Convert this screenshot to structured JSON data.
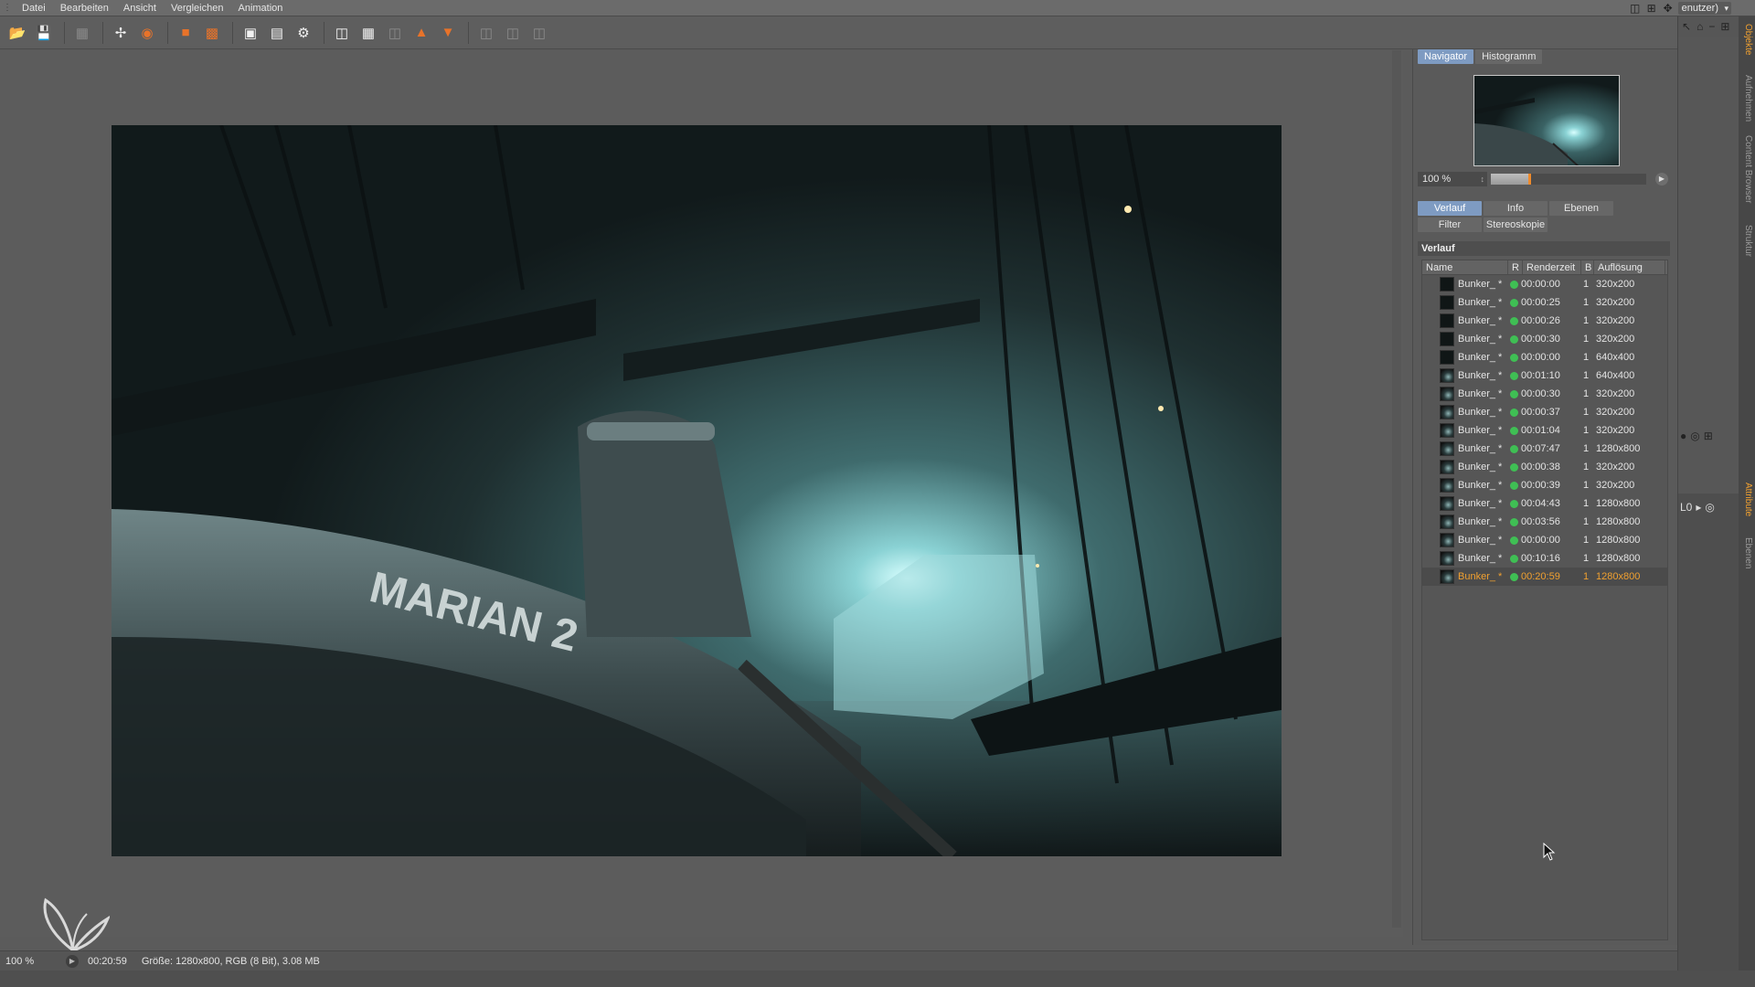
{
  "menu": {
    "items": [
      "Datei",
      "Bearbeiten",
      "Ansicht",
      "Vergleichen",
      "Animation"
    ],
    "layout_label": "enutzer)"
  },
  "toolbar": {
    "icons": [
      "open-icon",
      "save-icon",
      "grid-icon",
      "fit-icon",
      "person-icon",
      "stop-icon",
      "stack-icon",
      "render-region-icon",
      "render-view-icon",
      "render-settings-icon",
      "compare-ab-icon",
      "compare-grid-icon",
      "ab-icon",
      "set-a-icon",
      "set-b-icon",
      "split-h-icon",
      "split-v-icon",
      "split-diag-icon"
    ]
  },
  "navigator": {
    "tabs": [
      "Navigator",
      "Histogramm"
    ],
    "zoom_value": "100 %",
    "zoom_fraction": 0.25
  },
  "panel": {
    "tabs_row1": [
      "Verlauf",
      "Info",
      "Ebenen"
    ],
    "tabs_row2": [
      "Filter",
      "Stereoskopie"
    ],
    "section_title": "Verlauf",
    "columns": {
      "name": "Name",
      "r": "R",
      "time": "Renderzeit",
      "b": "B",
      "res": "Auflösung"
    },
    "rows": [
      {
        "name": "Bunker_ *",
        "time": "00:00:00",
        "b": "1",
        "res": "320x200"
      },
      {
        "name": "Bunker_ *",
        "time": "00:00:25",
        "b": "1",
        "res": "320x200"
      },
      {
        "name": "Bunker_ *",
        "time": "00:00:26",
        "b": "1",
        "res": "320x200"
      },
      {
        "name": "Bunker_ *",
        "time": "00:00:30",
        "b": "1",
        "res": "320x200"
      },
      {
        "name": "Bunker_ *",
        "time": "00:00:00",
        "b": "1",
        "res": "640x400"
      },
      {
        "name": "Bunker_ *",
        "time": "00:01:10",
        "b": "1",
        "res": "640x400"
      },
      {
        "name": "Bunker_ *",
        "time": "00:00:30",
        "b": "1",
        "res": "320x200"
      },
      {
        "name": "Bunker_ *",
        "time": "00:00:37",
        "b": "1",
        "res": "320x200"
      },
      {
        "name": "Bunker_ *",
        "time": "00:01:04",
        "b": "1",
        "res": "320x200"
      },
      {
        "name": "Bunker_ *",
        "time": "00:07:47",
        "b": "1",
        "res": "1280x800"
      },
      {
        "name": "Bunker_ *",
        "time": "00:00:38",
        "b": "1",
        "res": "320x200"
      },
      {
        "name": "Bunker_ *",
        "time": "00:00:39",
        "b": "1",
        "res": "320x200"
      },
      {
        "name": "Bunker_ *",
        "time": "00:04:43",
        "b": "1",
        "res": "1280x800"
      },
      {
        "name": "Bunker_ *",
        "time": "00:03:56",
        "b": "1",
        "res": "1280x800"
      },
      {
        "name": "Bunker_ *",
        "time": "00:00:00",
        "b": "1",
        "res": "1280x800"
      },
      {
        "name": "Bunker_ *",
        "time": "00:10:16",
        "b": "1",
        "res": "1280x800"
      },
      {
        "name": "Bunker_ *",
        "time": "00:20:59",
        "b": "1",
        "res": "1280x800",
        "selected": true
      }
    ]
  },
  "image": {
    "hull_text": "MARIAN 2"
  },
  "status": {
    "zoom": "100 %",
    "time": "00:20:59",
    "info": "Größe: 1280x800, RGB (8 Bit), 3.08 MB"
  },
  "side_tabs": [
    "Objekte",
    "Aufnehmen",
    "Content Browser",
    "Struktur",
    "Attribute",
    "Ebenen"
  ],
  "colors": {
    "accent_tab": "#7e9bc2",
    "selected_row": "#f0a030",
    "status_dot": "#3fbf54"
  }
}
